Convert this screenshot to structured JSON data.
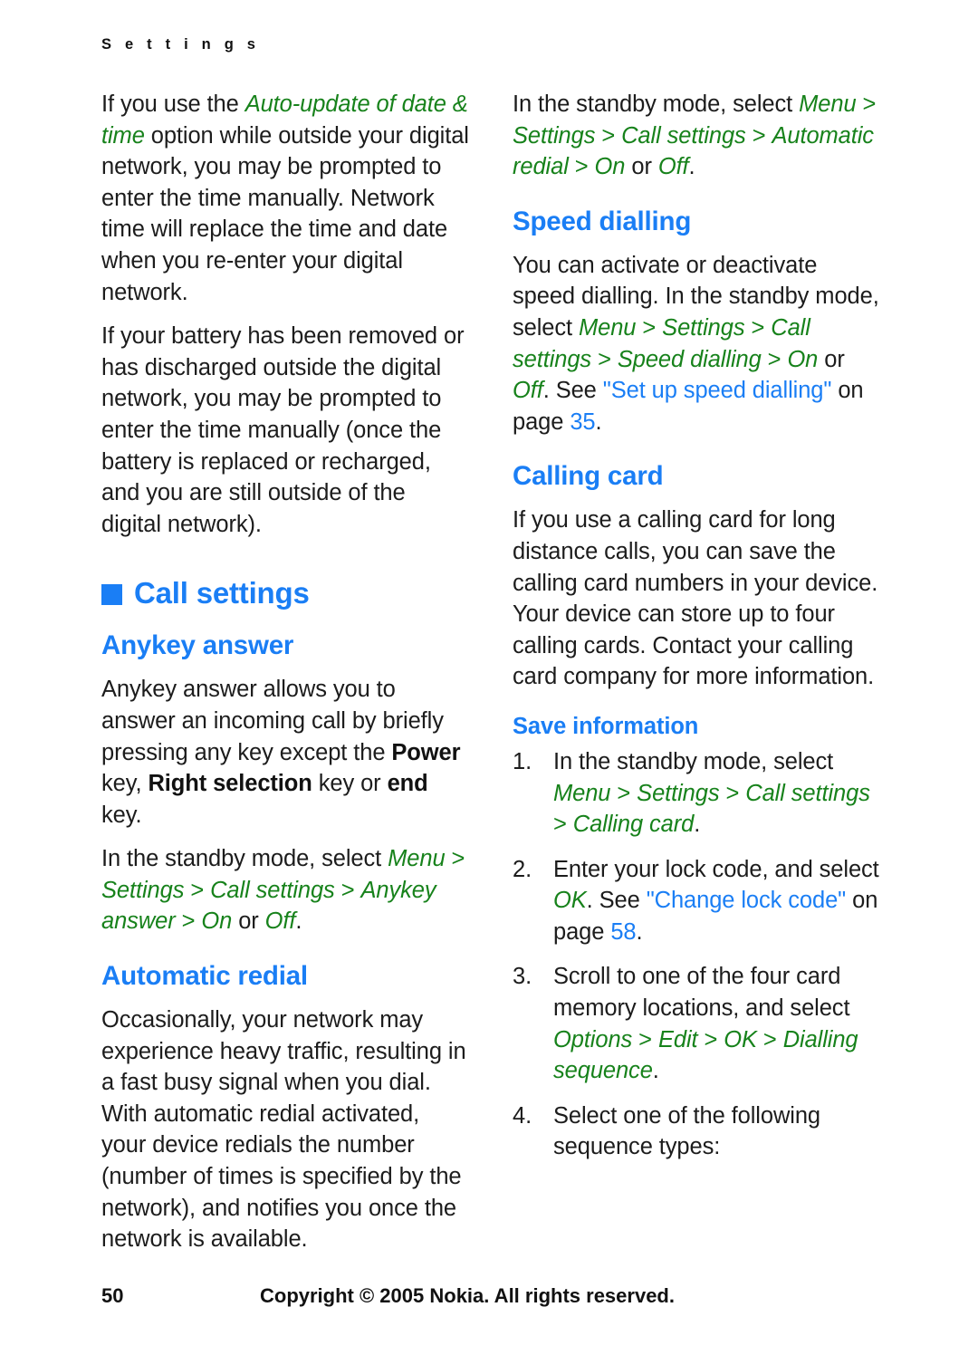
{
  "running_header": "S e t t i n g s",
  "colors": {
    "accent_blue": "#1a7ef5",
    "ui_green": "#17821b",
    "body_text": "#1c1c1c"
  },
  "left_column": {
    "para_1": {
      "t1": "If you use the ",
      "ui1": "Auto-update of date & time",
      "t2": " option while outside your digital network, you may be prompted to enter the time manually. Network time will replace the time and date when you re-enter your digital network."
    },
    "para_2": "If your battery has been removed or has discharged outside the digital network, you may be prompted to enter the time manually (once the battery is replaced or recharged, and you are still outside of the digital network).",
    "chapter_heading": "Call settings",
    "anykey": {
      "heading": "Anykey answer",
      "body": {
        "t1": "Anykey answer allows you to answer an incoming call by briefly pressing any key except the ",
        "b1": "Power",
        "t2": " key, ",
        "b2": "Right selection",
        "t3": " key or ",
        "b3": "end",
        "t4": " key."
      },
      "path": {
        "t1": "In the standby mode, select ",
        "ui1": "Menu",
        "s1": " > ",
        "ui2": "Settings",
        "s2": " > ",
        "ui3": "Call settings",
        "s3": " > ",
        "ui4": "Anykey answer",
        "s4": " > ",
        "ui5": "On",
        "t2": " or ",
        "ui6": "Off",
        "t3": "."
      }
    },
    "auto_redial": {
      "heading": "Automatic redial",
      "body": "Occasionally, your network may experience heavy traffic, resulting in a fast busy signal when you dial. With automatic redial activated, your device redials the number (number of times is specified by the network), and notifies you once the network is available."
    }
  },
  "right_column": {
    "redial_path": {
      "t1": "In the standby mode, select ",
      "ui1": "Menu",
      "s1": " > ",
      "ui2": "Settings",
      "s2": " > ",
      "ui3": "Call settings",
      "s3": " > ",
      "ui4": "Automatic redial",
      "s4": " > ",
      "ui5": "On",
      "t2": " or ",
      "ui6": "Off",
      "t3": "."
    },
    "speed_dialling": {
      "heading": "Speed dialling",
      "body": {
        "t1": "You can activate or deactivate speed dialling. In the standby mode, select ",
        "ui1": "Menu",
        "s1": " > ",
        "ui2": "Settings",
        "s2": " > ",
        "ui3": "Call settings",
        "s3": " > ",
        "ui4": "Speed dialling",
        "s4": " > ",
        "ui5": "On",
        "t2": " or ",
        "ui6": "Off",
        "t3": ". See ",
        "link": "\"Set up speed dialling\"",
        "t4": " on page ",
        "page": "35",
        "t5": "."
      }
    },
    "calling_card": {
      "heading": "Calling card",
      "body": "If you use a calling card for long distance calls, you can save the calling card numbers in your device. Your device can store up to four calling cards. Contact your calling card company for more information."
    },
    "save_information": {
      "heading": "Save information",
      "steps": [
        {
          "num": "1.",
          "t1": "In the standby mode, select ",
          "ui1": "Menu",
          "s1": " > ",
          "ui2": "Settings",
          "s2": " > ",
          "ui3": "Call settings",
          "s3": " > ",
          "ui4": "Calling card",
          "t2": "."
        },
        {
          "num": "2.",
          "t1": "Enter your lock code, and select ",
          "ui1": "OK",
          "t2": ". See ",
          "link": "\"Change lock code\"",
          "t3": " on page ",
          "page": "58",
          "t4": "."
        },
        {
          "num": "3.",
          "t1": "Scroll to one of the four card memory locations, and select ",
          "ui1": "Options",
          "s1": " > ",
          "ui2": "Edit",
          "s2": " > ",
          "ui3": "OK",
          "s3": " > ",
          "ui4": "Dialling sequence",
          "t2": "."
        },
        {
          "num": "4.",
          "t1": "Select one of the following sequence types:"
        }
      ]
    }
  },
  "footer": {
    "page_number": "50",
    "copyright": "Copyright © 2005 Nokia. All rights reserved."
  }
}
